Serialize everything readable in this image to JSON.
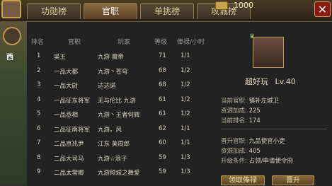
{
  "tabs": [
    {
      "label": "功勋榜"
    },
    {
      "label": "官职"
    },
    {
      "label": "单挑榜"
    },
    {
      "label": "攻城榜"
    }
  ],
  "gold": "1000",
  "side_label": "西",
  "table": {
    "headers": [
      "排名",
      "官职",
      "玩家",
      "等级",
      "俸禄/小时"
    ],
    "rows": [
      {
        "rank": "1",
        "title": "吴王",
        "player": "九游 魔帝",
        "level": "71",
        "fund": "1/1"
      },
      {
        "rank": "2",
        "title": "一品大都",
        "player": "九游丶苍穹",
        "level": "68",
        "fund": "1/2"
      },
      {
        "rank": "3",
        "title": "一品大尉",
        "player": "达达诺",
        "level": "68",
        "fund": "1/2"
      },
      {
        "rank": "4",
        "title": "一品征东将军",
        "player": "无与伦比 九游",
        "level": "61",
        "fund": "1/2"
      },
      {
        "rank": "5",
        "title": "一品丞相",
        "player": "九游丶王者何辉",
        "level": "61",
        "fund": "1/2"
      },
      {
        "rank": "6",
        "title": "二品征南将军",
        "player": "九游。风",
        "level": "62",
        "fund": "1/1"
      },
      {
        "rank": "7",
        "title": "二品京兆尹",
        "player": "江东 美周郎",
        "level": "60",
        "fund": "1/1"
      },
      {
        "rank": "8",
        "title": "二品大司马",
        "player": "九游☆浪子",
        "level": "59",
        "fund": "1/3"
      },
      {
        "rank": "9",
        "title": "二品太常卿",
        "player": "九游倾城之舞爱",
        "level": "59",
        "fund": "1/3"
      }
    ]
  },
  "profile": {
    "name": "超好玩",
    "level": "Lv.40",
    "current_title_label": "当前官职:",
    "current_title_value": "镇补左城卫",
    "fund_label": "资源加成:",
    "fund_value": "225",
    "rank_label": "当前排名:",
    "rank_value": "174",
    "next_title_label": "晋升官职:",
    "next_title_value": "九品使官小吏",
    "next_fund_label": "资源加成:",
    "next_fund_value": "405",
    "cond_label": "升级条件:",
    "cond_value": "占领/申请使令府"
  },
  "buttons": {
    "claim": "领取俸禄",
    "promote": "晋升"
  },
  "colors": {
    "accent": "#c9a24c",
    "close": "#8b1a12"
  }
}
